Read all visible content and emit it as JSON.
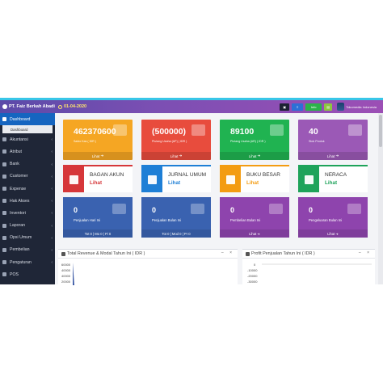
{
  "header": {
    "company": "PT. Faiz Berkah Abadi",
    "date": "01-04-2020",
    "btn_dark": "▣",
    "btn_blue": "≡",
    "btn_green": "Info",
    "btn_lime": "▤",
    "user_name": "Tokomedia Indonesia",
    "colors": {
      "accent": "#38c6e8",
      "header": "#7b4fb3"
    }
  },
  "sidebar": {
    "items": [
      {
        "label": "Dashboard",
        "icon": "dashboard-icon",
        "active": true
      },
      {
        "label": "Akuntansi",
        "icon": "book-icon"
      },
      {
        "label": "Atribut",
        "icon": "cart-icon"
      },
      {
        "label": "Bank",
        "icon": "bank-icon"
      },
      {
        "label": "Customer",
        "icon": "users-icon"
      },
      {
        "label": "Expense",
        "icon": "money-icon"
      },
      {
        "label": "Hak Akses",
        "icon": "key-icon"
      },
      {
        "label": "Inventori",
        "icon": "box-icon"
      },
      {
        "label": "Laporan",
        "icon": "report-icon"
      },
      {
        "label": "Opsi Umum",
        "icon": "settings-icon"
      },
      {
        "label": "Pembelian",
        "icon": "truck-icon"
      },
      {
        "label": "Pengaturan",
        "icon": "gear-icon"
      },
      {
        "label": "POS",
        "icon": "pos-icon"
      }
    ],
    "sub_dashboard": "Dashboard"
  },
  "cards": [
    {
      "value": "462370600",
      "label": "Saldo Kas ( IDR )",
      "footer": "Lihat",
      "color": "#f5a623"
    },
    {
      "value": "(500000)",
      "label": "Piutang Usaha (AP) ( IDR )",
      "footer": "Lihat",
      "color": "#e84c3d"
    },
    {
      "value": "89100",
      "label": "Piutang Usaha (AR) ( IDR )",
      "footer": "Lihat",
      "color": "#20b351"
    },
    {
      "value": "40",
      "label": "Stok Produk",
      "footer": "Lihat",
      "color": "#9b59b6"
    }
  ],
  "acards": [
    {
      "title": "BAGAN AKUN",
      "link": "Lihat",
      "color": "#d6373a"
    },
    {
      "title": "JURNAL UMUM",
      "link": "Lihat",
      "color": "#1e7fd6"
    },
    {
      "title": "BUKU BESAR",
      "link": "Lihat",
      "color": "#f39c12"
    },
    {
      "title": "NERACA",
      "link": "Lihat",
      "color": "#1ea35a"
    }
  ],
  "scards": [
    {
      "value": "0",
      "label": "Penjualan Hari Ini",
      "footer": "Tot 0 | Mo 0 | Pi 0",
      "color": "#3a62b0"
    },
    {
      "value": "0",
      "label": "Penjualan Bulan Ini",
      "footer": "Tot 0 | Mod 0 | Pr 0",
      "color": "#3a62b0"
    },
    {
      "value": "0",
      "label": "Pembelian Bulan Ini",
      "footer": "Lihat",
      "color": "#8e44ad"
    },
    {
      "value": "0",
      "label": "Pengeluaran Bulan Ini",
      "footer": "Lihat",
      "color": "#8e44ad"
    }
  ],
  "panels": {
    "left_title": "Total Revenue & Modal Tahun Ini ( IDR )",
    "left_ticks": [
      "60000",
      "40000",
      "40000",
      "20000"
    ],
    "right_title": "Profit Penjualan Tahun Ini ( IDR )",
    "right_ticks": [
      "0",
      "-10000",
      "-20000",
      "-30000"
    ],
    "controls": "– ×"
  }
}
